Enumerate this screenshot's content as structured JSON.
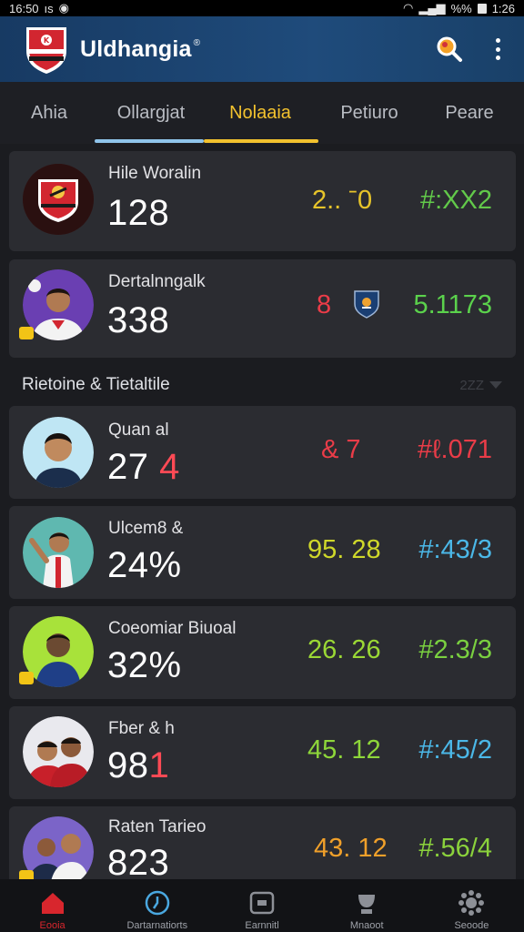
{
  "status_bar": {
    "time": "16:50",
    "left_text": "ıs",
    "battery": "%%",
    "clock": "1:26"
  },
  "app": {
    "title": "Uldhangia",
    "title_mark": "®"
  },
  "tabs": [
    {
      "label": "Ahia",
      "active": false
    },
    {
      "label": "Ollargjat",
      "active": false
    },
    {
      "label": "Nolaaia",
      "active": true
    },
    {
      "label": "Petiuro",
      "active": false
    },
    {
      "label": "Peare",
      "active": false
    }
  ],
  "top_cards": [
    {
      "name": "Hile Woralin",
      "score": "128",
      "stat_mid": "2.. ˉ0",
      "stat_right": "#:ХХ2",
      "mid_color": "#e7c42a",
      "right_color": "#62c94a"
    },
    {
      "name": "Dertalnngalk",
      "score": "338",
      "stat_mid": "8",
      "stat_right": "5.1173",
      "mid_color": "#ea3c48",
      "right_color": "#5bd24c"
    }
  ],
  "section": {
    "label": "Rietoine & Tietaltile",
    "value": "2ΖΖ"
  },
  "list_cards": [
    {
      "name": "Quan al",
      "score": "27",
      "score_tail": "4",
      "stat_mid": "&  7",
      "stat_right": "#ℓ.071",
      "mid_color": "#ea3c48",
      "right_color": "#ea3c48"
    },
    {
      "name": "Ulcem8 &",
      "score": "24%",
      "score_tail": "",
      "stat_mid": "95. 28",
      "stat_right": "#:43/3",
      "mid_color": "#cfd82a",
      "right_color": "#4bb8e8"
    },
    {
      "name": "Coeomiar Biuoal",
      "score": "32%",
      "score_tail": "",
      "stat_mid": "26. 26",
      "stat_right": "#2.3/3",
      "mid_color": "#9bd835",
      "right_color": "#7ad040"
    },
    {
      "name": "Fber & h",
      "score": "98",
      "score_tail": "1",
      "stat_mid": "45. 12",
      "stat_right": "#:45/2",
      "mid_color": "#8ed63a",
      "right_color": "#4bb8e8"
    },
    {
      "name": "Raten Tarieo",
      "score": "823",
      "score_tail": "",
      "stat_mid": "43. 12",
      "stat_right": "#.56/4",
      "mid_color": "#f0a02a",
      "right_color": "#8bd23c"
    }
  ],
  "bottom_nav": [
    {
      "label": "Eooia",
      "icon": "home-icon",
      "active": true
    },
    {
      "label": "Dartarnatiorts",
      "icon": "clock-icon",
      "active": false
    },
    {
      "label": "Earnnitl",
      "icon": "wallet-icon",
      "active": false
    },
    {
      "label": "Mnaoot",
      "icon": "trophy-icon",
      "active": false
    },
    {
      "label": "Seoode",
      "icon": "settings-icon",
      "active": false
    }
  ],
  "colors": {
    "accent": "#f3c22e",
    "app_bar": "#1f4b7b",
    "card": "#2b2c31",
    "active_nav": "#d8262d"
  }
}
